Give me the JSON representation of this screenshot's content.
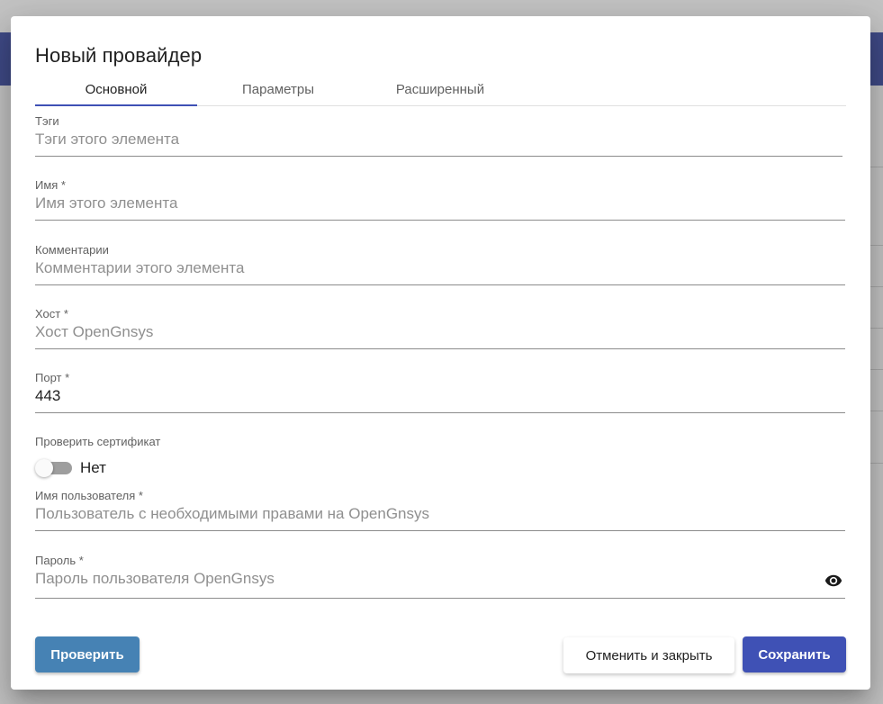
{
  "dialog": {
    "title": "Новый провайдер",
    "tabs": [
      {
        "label": "Основной",
        "active": true
      },
      {
        "label": "Параметры",
        "active": false
      },
      {
        "label": "Расширенный",
        "active": false
      }
    ]
  },
  "fields": {
    "tags": {
      "label": "Тэги",
      "placeholder": "Тэги этого элемента",
      "value": ""
    },
    "name": {
      "label": "Имя *",
      "placeholder": "Имя этого элемента",
      "value": ""
    },
    "comments": {
      "label": "Комментарии",
      "placeholder": "Комментарии этого элемента",
      "value": ""
    },
    "host": {
      "label": "Хост *",
      "placeholder": "Хост OpenGnsys",
      "value": ""
    },
    "port": {
      "label": "Порт *",
      "placeholder": "",
      "value": "443"
    },
    "verify_cert": {
      "label": "Проверить сертификат",
      "state_text": "Нет",
      "checked": false
    },
    "username": {
      "label": "Имя пользователя *",
      "placeholder": "Пользователь с необходимыми правами на OpenGnsys",
      "value": ""
    },
    "password": {
      "label": "Пароль *",
      "placeholder": "Пароль пользователя OpenGnsys",
      "value": ""
    }
  },
  "buttons": {
    "test": "Проверить",
    "cancel": "Отменить и закрыть",
    "save": "Сохранить"
  },
  "colors": {
    "primary": "#3f51b5",
    "test_button": "#4682b4"
  },
  "icons": {
    "password_visibility": "eye-icon"
  }
}
